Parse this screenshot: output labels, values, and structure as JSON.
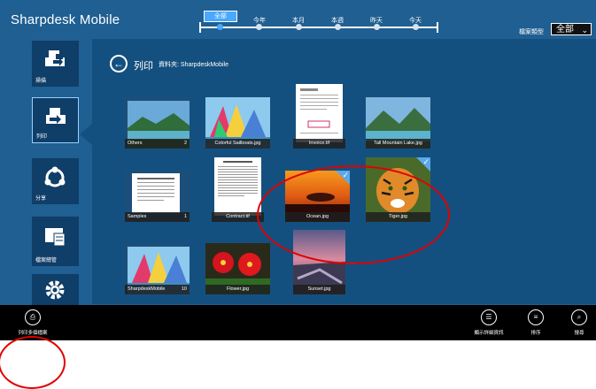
{
  "header": {
    "app_title": "Sharpdesk Mobile",
    "timeline": {
      "active_label": "全部",
      "labels": [
        "今年",
        "本月",
        "本週",
        "昨天",
        "今天"
      ]
    },
    "filetype_label": "檔案類型",
    "filetype_value": "全部"
  },
  "sidebar": {
    "items": [
      {
        "label": "掃描",
        "icon": "scan-icon"
      },
      {
        "label": "列印",
        "icon": "print-icon"
      },
      {
        "label": "分享",
        "icon": "share-icon"
      },
      {
        "label": "檔案總管",
        "icon": "file-manager-icon"
      },
      {
        "label": "",
        "icon": "settings-icon"
      }
    ]
  },
  "content": {
    "title": "列印",
    "folder_path": "資料夾: SharpdeskMobile",
    "tiles": [
      {
        "name": "Others",
        "count": "2",
        "type": "folder"
      },
      {
        "name": "Colorful Sailboats.jpg",
        "type": "image"
      },
      {
        "name": "Invoice.tif",
        "type": "document"
      },
      {
        "name": "Tall Mountain Lake.jpg",
        "type": "image"
      },
      {
        "name": "Samples",
        "count": "1",
        "type": "folder"
      },
      {
        "name": "Contract.tif",
        "type": "document"
      },
      {
        "name": "Ocean.jpg",
        "type": "image",
        "selected": true
      },
      {
        "name": "Tiger.jpg",
        "type": "image",
        "selected": true
      },
      {
        "name": "SharpdeskMobile",
        "count": "10",
        "type": "folder"
      },
      {
        "name": "Flower.jpg",
        "type": "image"
      },
      {
        "name": "Sunset.jpg",
        "type": "image"
      }
    ]
  },
  "bottombar": {
    "left_button": "列印多個檔案",
    "right_buttons": [
      {
        "label": "顯示詳細資訊",
        "icon": "details-icon"
      },
      {
        "label": "排序",
        "icon": "sort-icon"
      },
      {
        "label": "搜尋",
        "icon": "search-icon"
      }
    ]
  },
  "colors": {
    "app_bg": "#1f5f92",
    "panel_bg": "#14507f",
    "accent": "#49a8ff",
    "annotation": "#e00000"
  }
}
